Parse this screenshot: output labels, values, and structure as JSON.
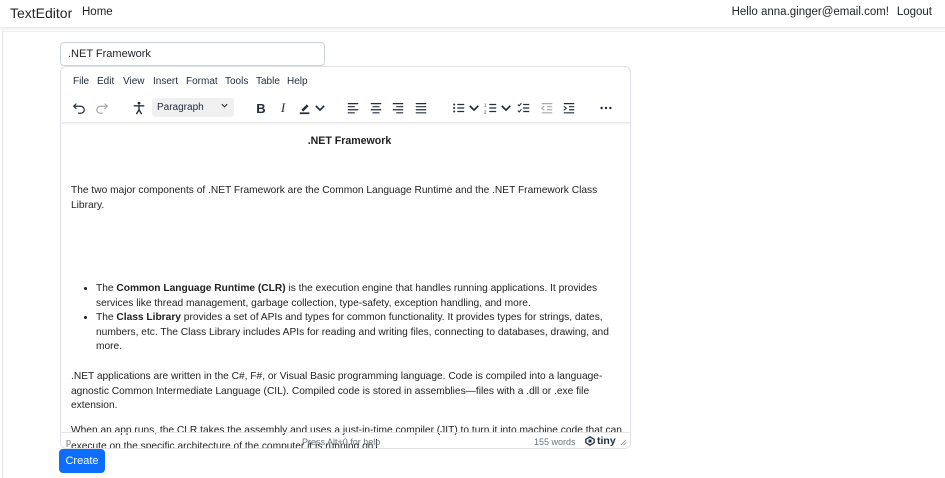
{
  "navbar": {
    "brand": "TextEditor",
    "home": "Home",
    "greeting": "Hello anna.ginger@email.com!",
    "logout": "Logout"
  },
  "form": {
    "title_value": ".NET Framework",
    "create_label": "Create"
  },
  "editor": {
    "menu": [
      "File",
      "Edit",
      "View",
      "Insert",
      "Format",
      "Tools",
      "Table",
      "Help"
    ],
    "block_format": "Paragraph",
    "heading": ".NET Framework",
    "para1": "The two major components of .NET Framework are the Common Language Runtime and the .NET Framework Class Library.",
    "bullet1": {
      "prefix": "The ",
      "bold": "Common Language Runtime (CLR)",
      "rest": " is the execution engine that handles running applications. It provides services like thread management, garbage collection, type-safety, exception handling, and more."
    },
    "bullet2": {
      "prefix": "The ",
      "bold": "Class Library",
      "rest": " provides a set of APIs and types for common functionality. It provides types for strings, dates, numbers, etc. The Class Library includes APIs for reading and writing files, connecting to databases, drawing, and more."
    },
    "para2": ".NET applications are written in the C#, F#, or Visual Basic programming language. Code is compiled into a language-agnostic Common Intermediate Language (CIL). Compiled code is stored in assemblies—files with a .dll or .exe file extension.",
    "para3": "When an app runs, the CLR takes the assembly and uses a just-in-time compiler (JIT) to turn it into machine code that can execute on the specific architecture of the computer it is running on.",
    "status": {
      "path": "p",
      "help": "Press Alt+0 for help",
      "words": "155 words",
      "logo": "tiny"
    }
  },
  "icons": [
    "undo-icon",
    "redo-icon",
    "accessibility-icon",
    "bold-icon",
    "italic-icon",
    "highlight-icon",
    "align-left-icon",
    "align-center-icon",
    "align-right-icon",
    "justify-icon",
    "bullet-list-icon",
    "numbered-list-icon",
    "checklist-icon",
    "outdent-icon",
    "indent-icon",
    "more-icon"
  ]
}
